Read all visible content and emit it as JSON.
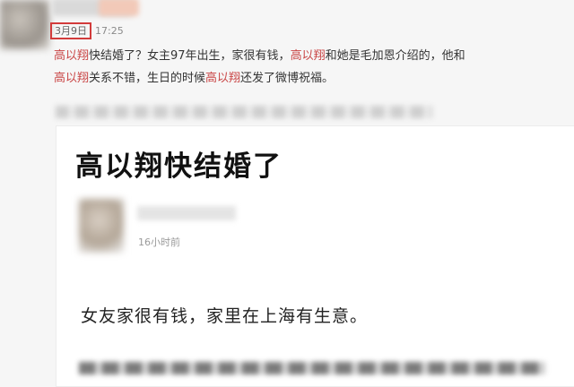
{
  "post": {
    "date": "3月9日",
    "time": "17:25",
    "line1": [
      {
        "text": "高以翔",
        "hl": true
      },
      {
        "text": "快结婚了？女主97年出生，家很有钱，",
        "hl": false
      },
      {
        "text": "高以翔",
        "hl": true
      },
      {
        "text": "和她是毛加恩介绍的，他和",
        "hl": false
      }
    ],
    "line2": [
      {
        "text": "高以翔",
        "hl": true
      },
      {
        "text": "关系不错，生日的时候",
        "hl": false
      },
      {
        "text": "高以翔",
        "hl": true
      },
      {
        "text": "还发了微博祝福。",
        "hl": false
      }
    ],
    "highlight_color": "#c94545",
    "date_border_color": "#d23b3b"
  },
  "card": {
    "title": "高以翔快结婚了",
    "time_ago": "16小时前",
    "body": "女友家很有钱，家里在上海有生意。"
  }
}
